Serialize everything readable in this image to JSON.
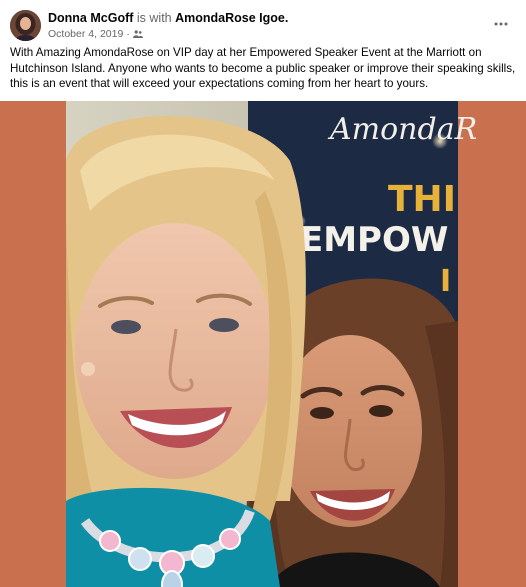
{
  "post": {
    "author": "Donna McGoff",
    "with_text": "is with",
    "tagged": "AmondaRose Igoe.",
    "date": "October 4, 2019",
    "date_separator": "·",
    "audience_icon": "friends-icon",
    "more_icon": "more-options-icon",
    "text": "With Amazing AmondaRose on VIP day at her Empowered Speaker Event at the Marriott on Hutchinson Island. Anyone who wants to become a public speaker or improve their speaking skills, this is an event that will exceed your expectations coming from her heart to yours."
  },
  "photo": {
    "banner_script": "AmondaR",
    "banner_line1": "THI",
    "banner_line2": "EMPOW",
    "banner_line3": "I",
    "colors": {
      "frame": "#c9704e",
      "banner": "#1d2a44",
      "banner_gold": "#e7b23a"
    }
  }
}
